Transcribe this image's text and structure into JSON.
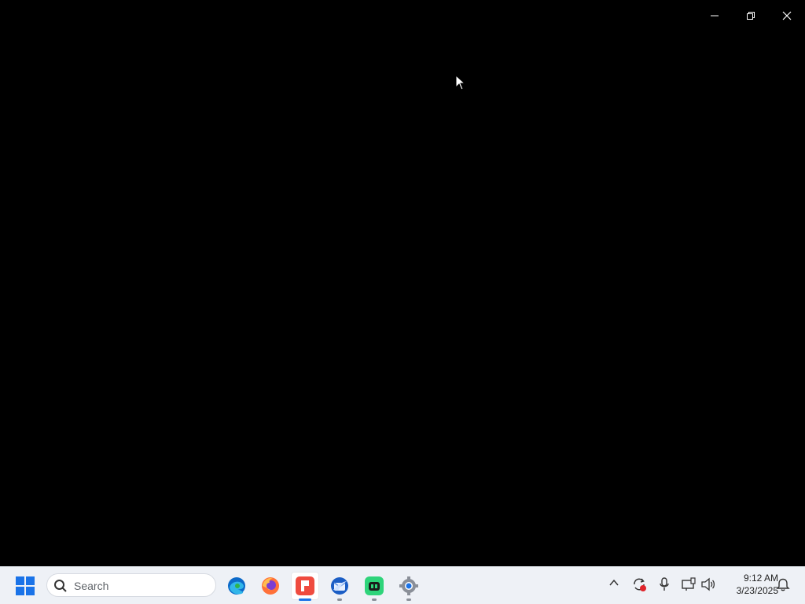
{
  "window": {
    "buttons": [
      {
        "name": "minimize",
        "icon": "minimize-icon"
      },
      {
        "name": "restore",
        "icon": "restore-icon"
      },
      {
        "name": "close",
        "icon": "close-icon"
      }
    ]
  },
  "taskbar": {
    "search_placeholder": "Search",
    "pinned_apps": [
      {
        "name": "Microsoft Edge",
        "icon": "edge-icon"
      },
      {
        "name": "Firefox",
        "icon": "firefox-icon"
      },
      {
        "name": "Red app",
        "icon": "red-app-icon",
        "active": true
      },
      {
        "name": "Thunderbird",
        "icon": "thunderbird-icon"
      },
      {
        "name": "Green app",
        "icon": "green-app-icon"
      },
      {
        "name": "Settings",
        "icon": "settings-icon"
      }
    ],
    "tray": {
      "icons": [
        "chevron-up-icon",
        "sync-icon",
        "microphone-icon",
        "network-icon",
        "volume-icon"
      ],
      "time": "9:12 AM",
      "date": "3/23/2025",
      "notifications_icon": "bell-icon"
    }
  },
  "colors": {
    "desktop_bg": "#000000",
    "taskbar_bg": "#eef1f6",
    "accent": "#1a73e8"
  }
}
